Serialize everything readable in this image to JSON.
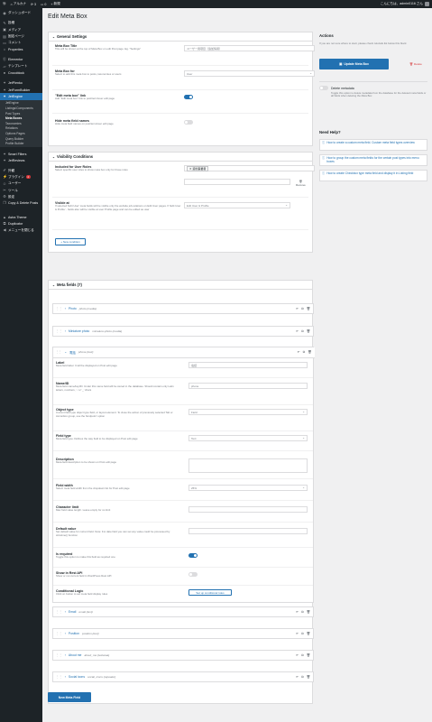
{
  "adminbar": {
    "site_name": "アルカナ",
    "updates": "3",
    "comments": "0",
    "new_label": "新規",
    "right_text": "こんにちは、admin0116 さん"
  },
  "sidebar": {
    "items": [
      {
        "label": "ダッシュボード",
        "icon": "dashboard-icon"
      },
      {
        "label": "投稿",
        "icon": "pin-icon"
      },
      {
        "label": "メディア",
        "icon": "media-icon"
      },
      {
        "label": "固定ページ",
        "icon": "page-icon"
      },
      {
        "label": "コメント",
        "icon": "comment-icon"
      },
      {
        "label": "Properties",
        "icon": "home-icon"
      },
      {
        "label": "Elementor",
        "icon": "elementor-icon"
      },
      {
        "label": "テンプレート",
        "icon": "folder-icon"
      },
      {
        "label": "Crocoblock",
        "icon": "croco-icon"
      },
      {
        "label": "JetPlenko",
        "icon": "puzzle-icon"
      },
      {
        "label": "JetFormBuilder",
        "icon": "form-icon"
      },
      {
        "label": "JetEngine",
        "icon": "engine-icon"
      }
    ],
    "submenu": [
      "JetEngine",
      "Listings/Components",
      "Post Types",
      "Meta Boxes",
      "Taxonomies",
      "Relations",
      "Options Pages",
      "Query Builder",
      "Profile Builder"
    ],
    "items2": [
      {
        "label": "Smart Filters",
        "icon": "filter-icon"
      },
      {
        "label": "JetReviews",
        "icon": "star-icon"
      },
      {
        "label": "外観",
        "icon": "brush-icon"
      },
      {
        "label": "プラグイン",
        "icon": "plugin-icon",
        "badge": "2"
      },
      {
        "label": "ユーザー",
        "icon": "user-icon"
      },
      {
        "label": "ツール",
        "icon": "wrench-icon"
      },
      {
        "label": "設定",
        "icon": "settings-icon"
      },
      {
        "label": "Copy & Delete Posts",
        "icon": "copy-icon"
      },
      {
        "label": "Astra Theme",
        "icon": "astra-icon"
      },
      {
        "label": "Duplicator",
        "icon": "duplicate-icon"
      },
      {
        "label": "メニューを閉じる",
        "icon": "collapse-icon"
      }
    ]
  },
  "page": {
    "title": "Edit Meta Box"
  },
  "general": {
    "heading": "General Settings",
    "title_label": "Meta Box Title",
    "title_desc": "Title will be shown at the top of Meta Box on edit Post page. Eg. \"Settings\"",
    "title_value": "ユーザー用項目（追加情報）",
    "for_label": "Meta Box for",
    "for_desc": "Select to add this meta box to posts, taxonomies or users",
    "for_value": "User",
    "link_label": "\"Edit meta box\" link",
    "link_desc": "Add \"Edit meta box\" link to post/term/user edit page",
    "hide_label": "Hide meta field names",
    "hide_desc": "Hide meta field names on post/term/user edit page"
  },
  "visibility": {
    "heading": "Visibility Conditions",
    "roles_label": "Included for User Roles",
    "roles_desc": "Select specific user roles to show meta box only for those roles",
    "role_tag": "契約事業者",
    "remove_label": "Remove",
    "visible_label": "Visible at",
    "visible_desc": "If selected 'Edit User' meta fields will be visible only the website job-relations on Edit User pages. If 'Edit User & Profile' - fields also will be visible at user Profile page and can be edited as user",
    "visible_value": "Edit User & Profile",
    "new_condition": "+ New condition"
  },
  "metafields": {
    "heading": "Meta fields (7)",
    "collapsed_top": [
      {
        "label": "Photo",
        "name": "photo (media)"
      },
      {
        "label": "Miniature photo",
        "name": "miniature-photo (media)"
      }
    ],
    "expanded": {
      "label": "電話",
      "name": "phone (text)"
    },
    "rows": [
      {
        "label": "Label",
        "desc": "Meta field label. It will be displayed on Post edit page",
        "value": "電話",
        "kind": "input"
      },
      {
        "label": "Name/ID",
        "desc": "Meta field name/key/ID. Under this name field will be stored in the database. Should contain only Latin letters, numbers, '-' or '_' chars",
        "value": "phone",
        "kind": "input"
      },
      {
        "label": "Object type",
        "desc": "Current field type object type field, or layout element. To close the action of previously selected Tab or Accordion group, use the 'Endpoint' option",
        "value": "Field",
        "kind": "select"
      },
      {
        "label": "Field type",
        "desc": "Meta field type. Defines the way field to be displayed on Post edit page",
        "value": "Text",
        "kind": "select"
      },
      {
        "label": "Description",
        "desc": "Meta field description to be shown on Post edit page",
        "value": "",
        "kind": "textarea"
      },
      {
        "label": "Field width",
        "desc": "Select meta field width from the dropdown list for Post edit page",
        "value": "25%",
        "kind": "select"
      },
      {
        "label": "Character limit",
        "desc": "Max field value length. Leave empty for no limit",
        "value": "",
        "kind": "input"
      },
      {
        "label": "Default value",
        "desc": "Set default value for current field. Note: For date field you can set any value could be processed by strtotime() function",
        "value": "",
        "kind": "input"
      },
      {
        "label": "Is required",
        "desc": "Toggle this option to make this field as required one",
        "value": "on",
        "kind": "toggle"
      },
      {
        "label": "Show in Rest API",
        "desc": "Show or not current field in WordPress Rest API",
        "value": "off",
        "kind": "toggle"
      },
      {
        "label": "Conditional Logic",
        "desc": "Click on button to set meta field display rules",
        "value": "Set up conditional rules",
        "kind": "button"
      }
    ],
    "collapsed_bottom": [
      {
        "label": "Email",
        "name": "email (text)"
      },
      {
        "label": "Position",
        "name": "position (text)"
      },
      {
        "label": "About me",
        "name": "about_me (textarea)"
      },
      {
        "label": "Social icons",
        "name": "social_icons (repeater)"
      }
    ],
    "new_field": "New Meta Field"
  },
  "actions": {
    "heading": "Actions",
    "note": "If you are not sure where to start, please check tutorials list below this block",
    "update_label": "Update Meta Box",
    "delete_label": "Delete",
    "delete_meta_label": "Delete metadata",
    "delete_meta_desc": "Toggle this option to delete metadata from the database for the deleted meta fields or all fields when deleting the Meta Box"
  },
  "help": {
    "heading": "Need Help?",
    "links": [
      "How to create a custom meta field. Custom meta field types overview",
      "How to group the custom meta fields for the certain post types into menu boxes",
      "How to create Checkbox type meta field and display it in Listing field"
    ]
  },
  "colors": {
    "accent": "#2271b1",
    "danger": "#d63638",
    "admin_bg": "#1d2327"
  }
}
